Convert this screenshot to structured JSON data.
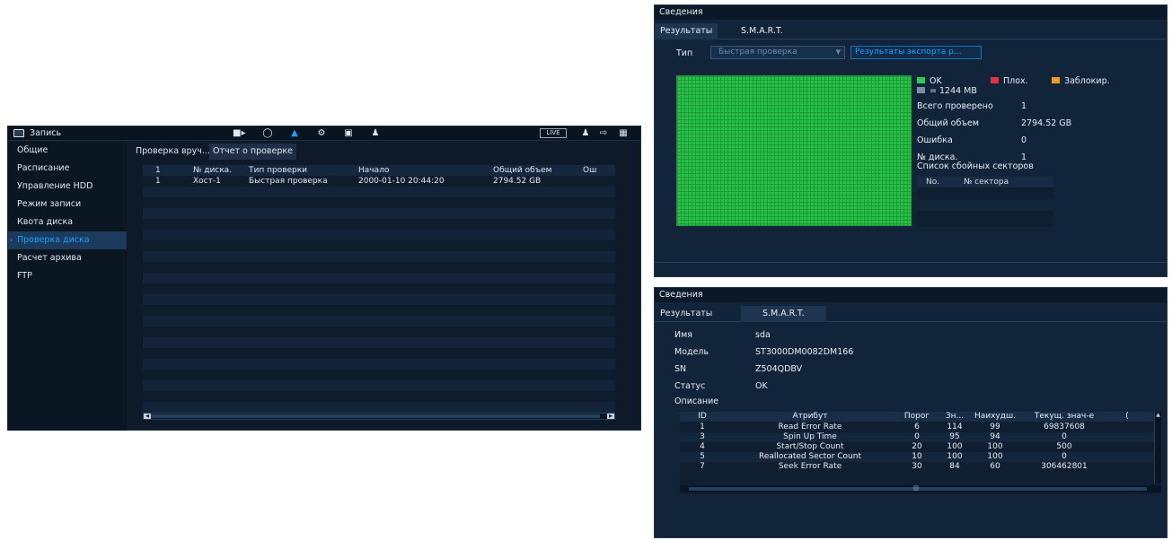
{
  "main": {
    "title": "Запись",
    "live_label": "LIVE",
    "sidebar": [
      {
        "label": "Общие"
      },
      {
        "label": "Расписание"
      },
      {
        "label": "Управление HDD"
      },
      {
        "label": "Режим записи"
      },
      {
        "label": "Квота диска"
      },
      {
        "label": "Проверка диска",
        "active": true
      },
      {
        "label": "Расчет архива"
      },
      {
        "label": "FTP"
      }
    ],
    "tabs": [
      "Проверка вруч...",
      "Отчет о проверке"
    ],
    "table": {
      "columns": [
        "1",
        "№ диска.",
        "Тип проверки",
        "Начало",
        "Общий объем",
        "Ош"
      ],
      "rows": [
        [
          "1",
          "Хост-1",
          "Быстрая проверка",
          "2000-01-10 20:44:20",
          "2794.52 GB",
          ""
        ]
      ]
    }
  },
  "details1": {
    "header": "Сведения",
    "tabs": [
      "Результаты",
      "S.M.A.R.T."
    ],
    "type_label": "Тип",
    "type_value": "Быстрая проверка",
    "export_button": "Результаты экспорта р...",
    "legend": {
      "ok": "OK",
      "bad": "Плох.",
      "blocked": "Заблокир.",
      "unit": "= 1244 MB"
    },
    "colors": {
      "ok": "#2ecc52",
      "bad": "#e53040",
      "blocked": "#f59a1a",
      "unit": "#7d8ea3"
    },
    "stats": [
      {
        "label": "Всего проверено",
        "value": "1"
      },
      {
        "label": "Общий объем",
        "value": "2794.52 GB"
      },
      {
        "label": "Ошибка",
        "value": "0"
      },
      {
        "label": "№ диска.",
        "value": "1"
      }
    ],
    "bad_sectors_title": "Список сбойных секторов",
    "bad_table_columns": [
      "No.",
      "№ сектора"
    ]
  },
  "details2": {
    "header": "Сведения",
    "tabs": [
      "Результаты",
      "S.M.A.R.T."
    ],
    "info": [
      {
        "label": "Имя",
        "value": "sda"
      },
      {
        "label": "Модель",
        "value": "ST3000DM0082DM166"
      },
      {
        "label": "SN",
        "value": "Z504QDBV"
      },
      {
        "label": "Статус",
        "value": "OK"
      }
    ],
    "description_label": "Описание",
    "smart": {
      "columns": [
        "ID",
        "Атрибут",
        "Порог",
        "Зн...",
        "Наихудш.",
        "Текущ. знач-е",
        "("
      ],
      "rows": [
        [
          "1",
          "Read Error Rate",
          "6",
          "114",
          "99",
          "69837608"
        ],
        [
          "3",
          "Spin Up Time",
          "0",
          "95",
          "94",
          "0"
        ],
        [
          "4",
          "Start/Stop Count",
          "20",
          "100",
          "100",
          "500"
        ],
        [
          "5",
          "Reallocated Sector Count",
          "10",
          "100",
          "100",
          "0"
        ],
        [
          "7",
          "Seek Error Rate",
          "30",
          "84",
          "60",
          "306462801"
        ]
      ]
    }
  }
}
